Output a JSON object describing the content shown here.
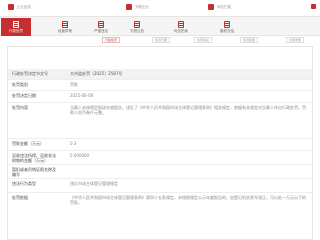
{
  "topbar": {
    "items": [
      {
        "label": "企业信息",
        "icon": "doc-icon"
      },
      {
        "label": "关联企业",
        "icon": "link-icon"
      },
      {
        "label": "风险扫描",
        "icon": "shield-icon"
      }
    ]
  },
  "toolbar": {
    "tools": [
      {
        "label": "行政处罚",
        "icon": "penalty-icon"
      },
      {
        "label": "经营异常",
        "icon": "alert-icon"
      },
      {
        "label": "严重违法",
        "icon": "warning-icon"
      },
      {
        "label": "欠税公告",
        "icon": "tax-icon"
      },
      {
        "label": "司法拍卖",
        "icon": "gavel-icon"
      },
      {
        "label": "股权冻结",
        "icon": "lock-icon"
      }
    ]
  },
  "filters": {
    "pills": [
      "行政处罚",
      "处罚日期",
      "处罚机关",
      "处罚结果",
      "全部类型"
    ]
  },
  "detail": {
    "rows": [
      {
        "label": "行政处罚决定书文号",
        "value": "大市监处罚〔2025〕2587号"
      },
      {
        "label": "处罚类别",
        "value": "罚款"
      },
      {
        "label": "处罚决定日期",
        "value": "2025-06-06"
      },
      {
        "label": "处罚内容",
        "value": "当事人未按规定报送年度报告，违反了《中华人民共和国市场主体登记管理条例》相关规定，依据有关规定对当事人作出行政处罚，罚款人民币叁仟元整。"
      },
      {
        "label": "罚款金额（万元）",
        "value": "0.3"
      },
      {
        "label": "没收违法所得、没收非法财物的金额（万元）",
        "value": "0.000000"
      },
      {
        "label": "暂扣或者吊销证照名称及编号",
        "value": ""
      },
      {
        "label": "违法行为类型",
        "value": "违反市场主体登记管理规定"
      },
      {
        "label": "处罚依据",
        "value": "《中华人民共和国市场主体登记管理条例》第四十五条规定，未按照规定公示年度报告的，由登记机关责令改正，可以处一万元以下的罚款。"
      }
    ]
  }
}
